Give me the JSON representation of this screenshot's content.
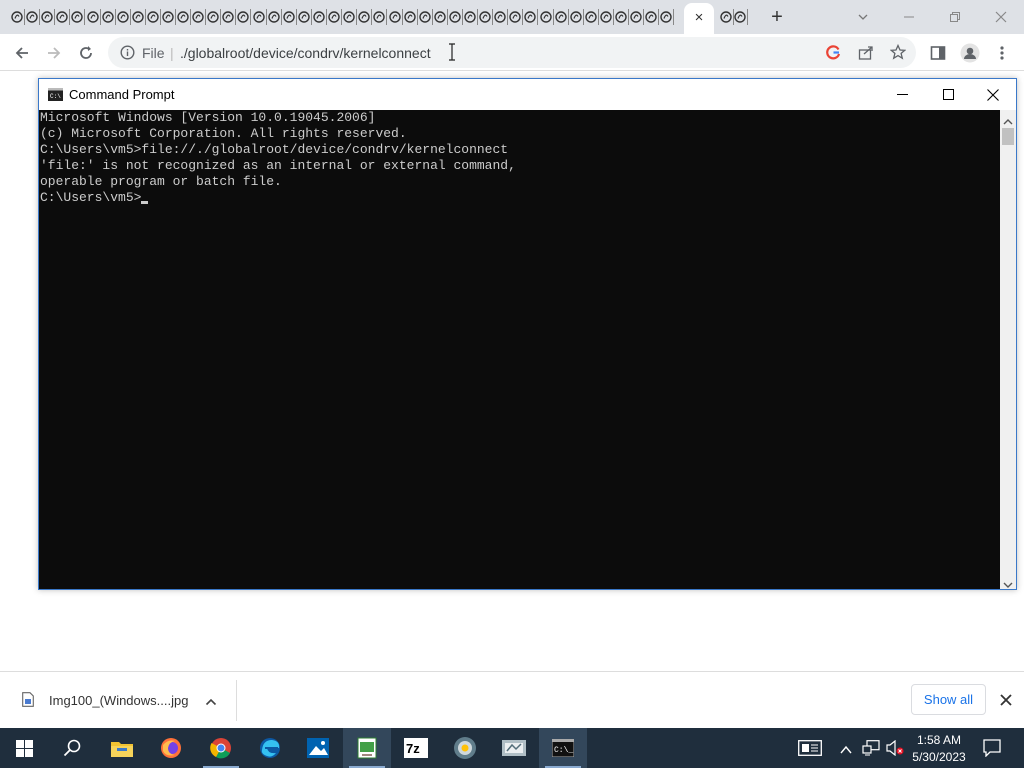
{
  "browser": {
    "address": {
      "site_label": "File",
      "separator": "|",
      "url": "./globalroot/device/condrv/kernelconnect"
    },
    "new_tab_symbol": "+",
    "tab_close_symbol": "×"
  },
  "cmd_window": {
    "title": "Command Prompt",
    "lines": [
      "Microsoft Windows [Version 10.0.19045.2006]",
      "(c) Microsoft Corporation. All rights reserved.",
      "",
      "C:\\Users\\vm5>file://./globalroot/device/condrv/kernelconnect",
      "'file:' is not recognized as an internal or external command,",
      "operable program or batch file.",
      "",
      "C:\\Users\\vm5>"
    ]
  },
  "download_bar": {
    "filename": "Img100_(Windows....jpg",
    "show_all_label": "Show all"
  },
  "taskbar": {
    "time": "1:58 AM",
    "date": "5/30/2023",
    "apps": [
      "start-icon",
      "search-icon",
      "file-explorer-icon",
      "firefox-icon",
      "chrome-icon",
      "edge-icon",
      "photos-icon",
      "app-icon",
      "7zip-icon",
      "app-icon",
      "app-icon",
      "cmd-icon"
    ]
  },
  "colors": {
    "tabstrip": "#dee1e6",
    "console_bg": "#0c0c0c",
    "console_text": "#cccccc",
    "taskbar": "#1f2e3d",
    "window_border": "#3a78c9"
  }
}
